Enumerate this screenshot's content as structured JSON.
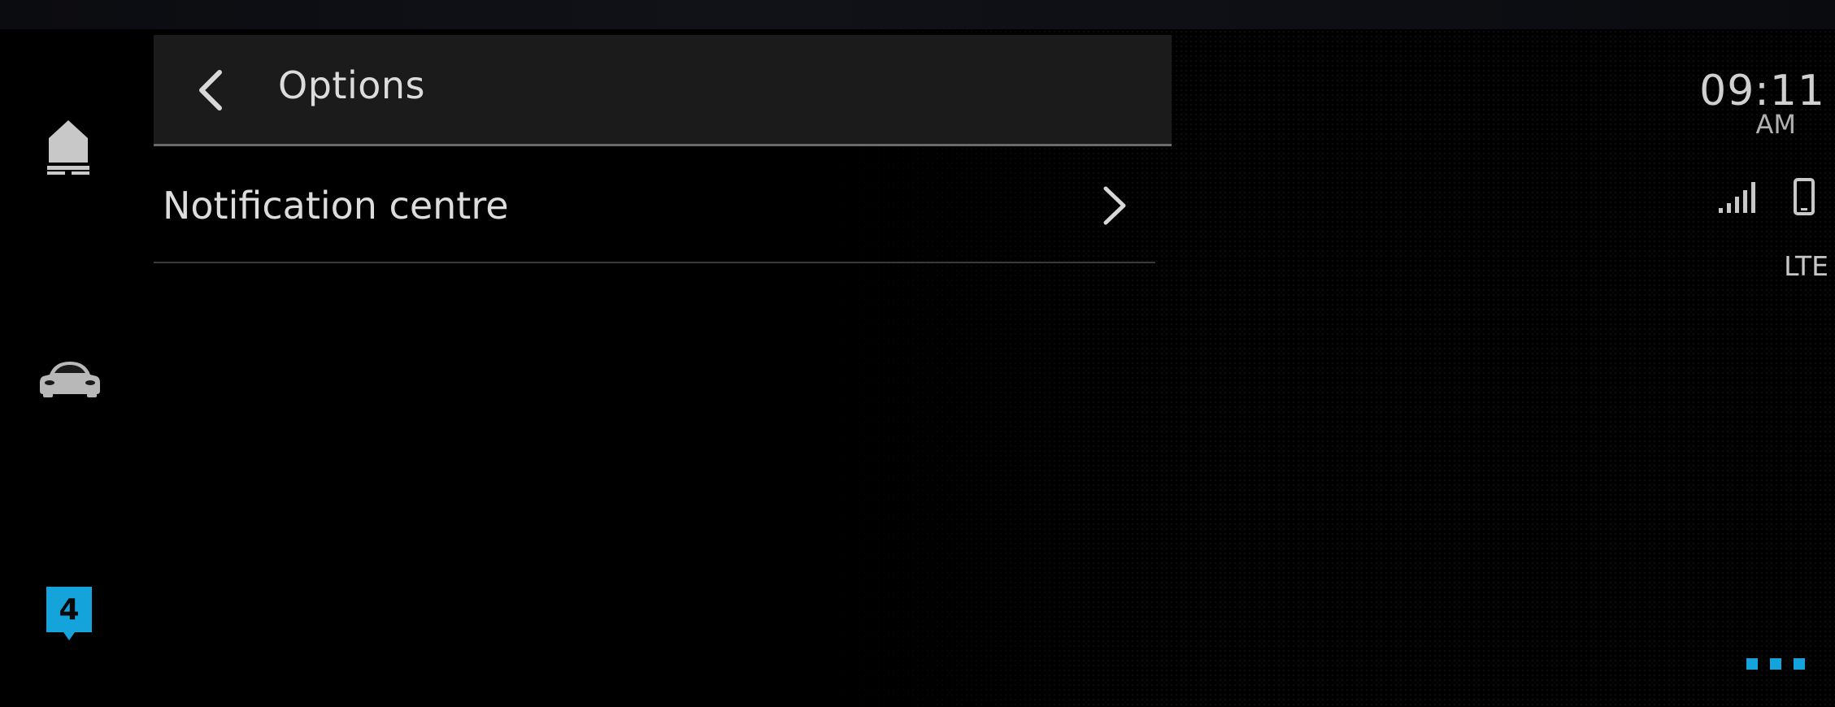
{
  "header": {
    "title": "Options"
  },
  "menu": {
    "items": [
      {
        "label": "Notification centre"
      }
    ]
  },
  "status": {
    "time": "09:11",
    "ampm": "AM",
    "network": "LTE"
  },
  "rail": {
    "notification_count": "4"
  },
  "icons": {
    "back": "chevron-left-icon",
    "home": "home-icon",
    "car": "car-icon",
    "chevron": "chevron-right-icon",
    "signal": "signal-strength-icon",
    "phone": "phone-icon",
    "more": "more-dots-icon"
  },
  "colors": {
    "accent": "#15a3dc",
    "background": "#000000",
    "header_bg": "#1b1b1b",
    "text": "#dcdcdc"
  }
}
